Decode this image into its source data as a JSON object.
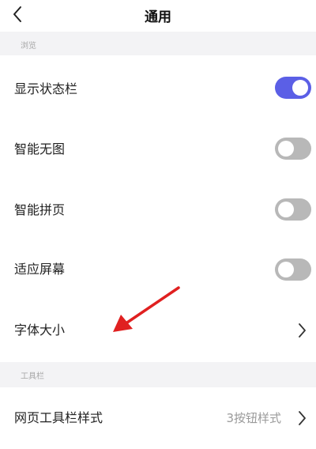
{
  "header": {
    "title": "通用",
    "back_icon": "chevron-left-icon"
  },
  "sections": {
    "browse": {
      "label": "浏览",
      "rows": {
        "show_status_bar": {
          "label": "显示状态栏",
          "toggle": "on"
        },
        "smart_no_images": {
          "label": "智能无图",
          "toggle": "off"
        },
        "smart_page_stitch": {
          "label": "智能拼页",
          "toggle": "off"
        },
        "fit_screen": {
          "label": "适应屏幕",
          "toggle": "off"
        },
        "font_size": {
          "label": "字体大小",
          "icon": "chevron-right-icon"
        }
      }
    },
    "toolbar": {
      "label": "工具栏",
      "rows": {
        "web_toolbar_style": {
          "label": "网页工具栏样式",
          "value": "3按钮样式",
          "icon": "chevron-right-icon"
        }
      }
    }
  },
  "colors": {
    "toggle_on": "#5b5fe6",
    "toggle_off": "#b8b8b8",
    "section_bg": "#f3f3f5",
    "annotation_arrow": "#e02020"
  }
}
